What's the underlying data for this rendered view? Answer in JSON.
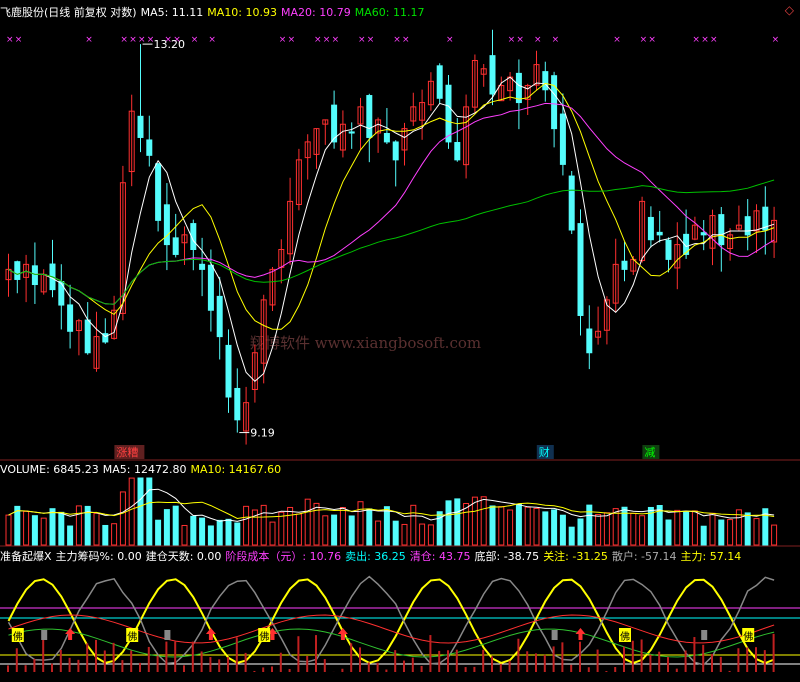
{
  "main_header": [
    {
      "text": "飞鹿股份(日线 前复权 对数)",
      "color": "#ffffff"
    },
    {
      "text": "MA5: 11.11",
      "color": "#ffffff"
    },
    {
      "text": "MA10: 10.93",
      "color": "#ffff00"
    },
    {
      "text": "MA20: 10.79",
      "color": "#ff40ff"
    },
    {
      "text": "MA60: 11.17",
      "color": "#00e000"
    }
  ],
  "volume_header": [
    {
      "text": "VOLUME: 6845.23",
      "color": "#ffffff"
    },
    {
      "text": "MA5: 12472.80",
      "color": "#ffffff"
    },
    {
      "text": "MA10: 14167.60",
      "color": "#ffff00"
    }
  ],
  "indicator_header": [
    {
      "text": "准备起爆X",
      "color": "#ffffff"
    },
    {
      "text": "主力筹码%: 0.00",
      "color": "#ffffff"
    },
    {
      "text": "建仓天数: 0.00",
      "color": "#ffffff"
    },
    {
      "text": "阶段成本（元）: 10.76",
      "color": "#ff40ff"
    },
    {
      "text": "卖出: 36.25",
      "color": "#00ffff"
    },
    {
      "text": "清仓: 43.75",
      "color": "#ff40ff"
    },
    {
      "text": "底部: -38.75",
      "color": "#ffffff"
    },
    {
      "text": "关注: -31.25",
      "color": "#ffff00"
    },
    {
      "text": "散户: -57.14",
      "color": "#aaaaaa"
    },
    {
      "text": "主力: 57.14",
      "color": "#ffff00"
    }
  ],
  "corner_icon": "diamond-icon",
  "annotations": {
    "high_label": "13.20",
    "low_label": "9.19",
    "watermark": "翔博软件 www.xiangbosoft.com"
  },
  "event_tags": [
    {
      "text": "涨糟",
      "bar": 13,
      "color": "#ff4040",
      "bg": "#602020"
    },
    {
      "text": "财",
      "bar": 61,
      "color": "#00ffff",
      "bg": "#103050"
    },
    {
      "text": "减",
      "bar": 73,
      "color": "#00ff00",
      "bg": "#104010"
    }
  ],
  "indicator_labels": {
    "signal": "佛"
  },
  "colors": {
    "up": "#ff3030",
    "down": "#54fcfc",
    "ma5": "#ffffff",
    "ma10": "#ffff00",
    "ma20": "#ff40ff",
    "ma60": "#00c000",
    "marker": "#ff40ff"
  },
  "chart_data": {
    "type": "candlestick",
    "scale": "log",
    "ylim": [
      9.0,
      13.5
    ],
    "bar_count": 88,
    "closes": [
      10.7,
      10.6,
      10.75,
      10.55,
      10.65,
      10.5,
      10.35,
      10.1,
      10.2,
      9.9,
      10.05,
      10.0,
      10.3,
      11.6,
      12.4,
      12.1,
      11.9,
      11.2,
      10.95,
      10.85,
      11.05,
      10.9,
      10.7,
      10.3,
      10.05,
      9.5,
      9.3,
      9.45,
      9.9,
      10.4,
      10.7,
      10.9,
      11.4,
      11.85,
      12.05,
      12.2,
      12.3,
      12.05,
      12.25,
      12.15,
      12.45,
      12.1,
      12.3,
      12.05,
      11.85,
      12.2,
      12.45,
      12.5,
      12.75,
      12.55,
      12.05,
      11.85,
      12.45,
      13.0,
      12.9,
      12.6,
      12.7,
      12.8,
      12.5,
      12.7,
      12.95,
      12.65,
      12.2,
      11.8,
      11.1,
      10.25,
      9.9,
      10.1,
      10.4,
      10.75,
      10.7,
      10.8,
      11.4,
      11.0,
      11.05,
      10.8,
      10.95,
      10.85,
      11.15,
      11.05,
      11.25,
      10.95,
      11.05,
      11.15,
      11.05,
      11.3,
      11.1,
      11.2
    ],
    "high_point": {
      "bar": 15,
      "value": 13.2
    },
    "low_point": {
      "bar": 26,
      "value": 9.19
    },
    "ma": {
      "MA5": 11.11,
      "MA10": 10.93,
      "MA20": 10.79,
      "MA60": 11.17
    },
    "volume": {
      "last": 6845.23,
      "ma5": 12472.8,
      "ma10": 14167.6
    }
  }
}
